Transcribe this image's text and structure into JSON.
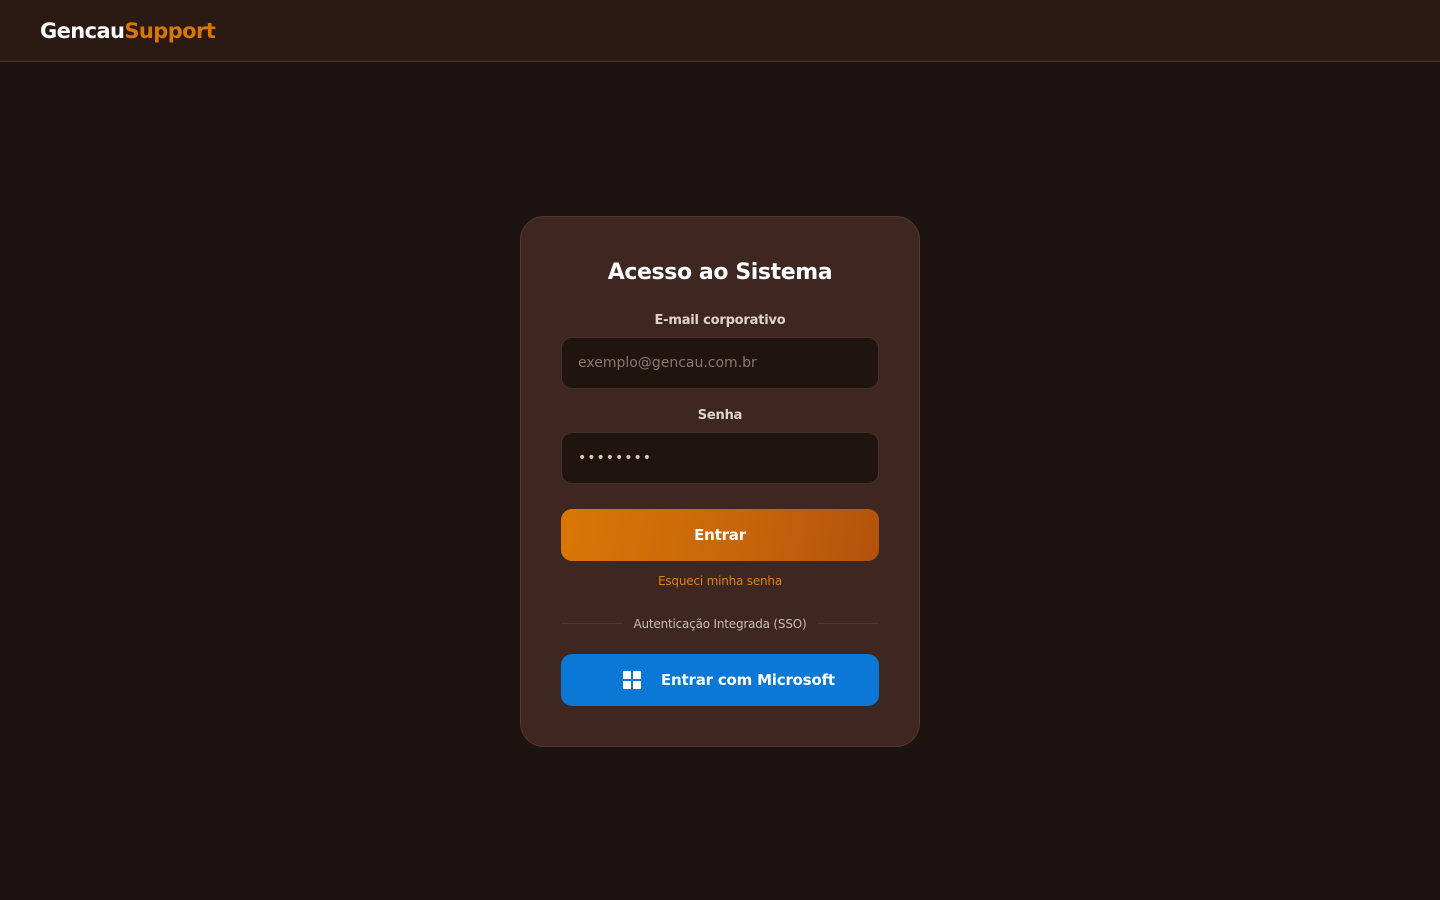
{
  "brand": {
    "name_main": "Gencau",
    "name_accent": "Support",
    "accent_color": "#d97706"
  },
  "login": {
    "title": "Acesso ao Sistema",
    "email_label": "E-mail corporativo",
    "email_placeholder": "exemplo@gencau.com.br",
    "email_value": "",
    "password_label": "Senha",
    "password_value": "••••••••",
    "submit_label": "Entrar",
    "forgot_label": "Esqueci minha senha",
    "sso_divider_label": "Autenticação Integrada (SSO)",
    "microsoft_label": "Entrar com Microsoft",
    "microsoft_icon": "microsoft-windows-icon",
    "microsoft_color": "#0b78d6"
  }
}
